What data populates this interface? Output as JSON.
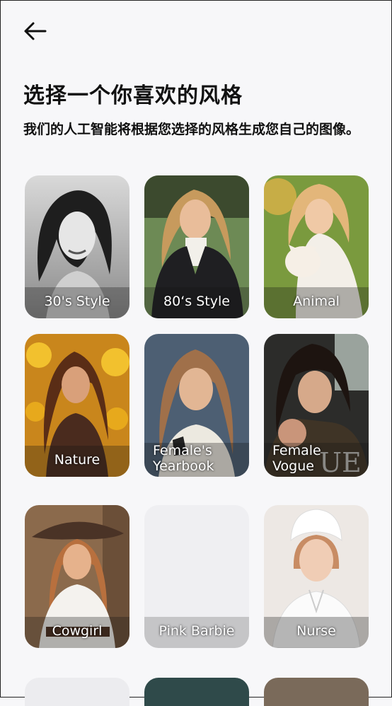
{
  "header": {
    "back_icon": "arrow-left-icon",
    "title": "选择一个你喜欢的风格",
    "subtitle": "我们的人工智能将根据您选择的风格生成您自己的图像。"
  },
  "styles": [
    {
      "label": "30's Style",
      "image": "vintage-portrait"
    },
    {
      "label": "80‘s Style",
      "image": "eighties-portrait"
    },
    {
      "label": "Animal",
      "image": "woman-with-cat"
    },
    {
      "label": "Nature",
      "image": "sunflower-portrait"
    },
    {
      "label": "Female's Yearbook",
      "image": "yearbook-portrait"
    },
    {
      "label": "Female Vogue",
      "image": "vogue-cover"
    },
    {
      "label": "Cowgirl",
      "image": "cowgirl-portrait"
    },
    {
      "label": "Pink Barbie",
      "image": "placeholder"
    },
    {
      "label": "Nurse",
      "image": "nurse-portrait"
    }
  ],
  "colors": {
    "background": "#f7f7f9",
    "text": "#111111",
    "card_placeholder": "#efeff2"
  }
}
